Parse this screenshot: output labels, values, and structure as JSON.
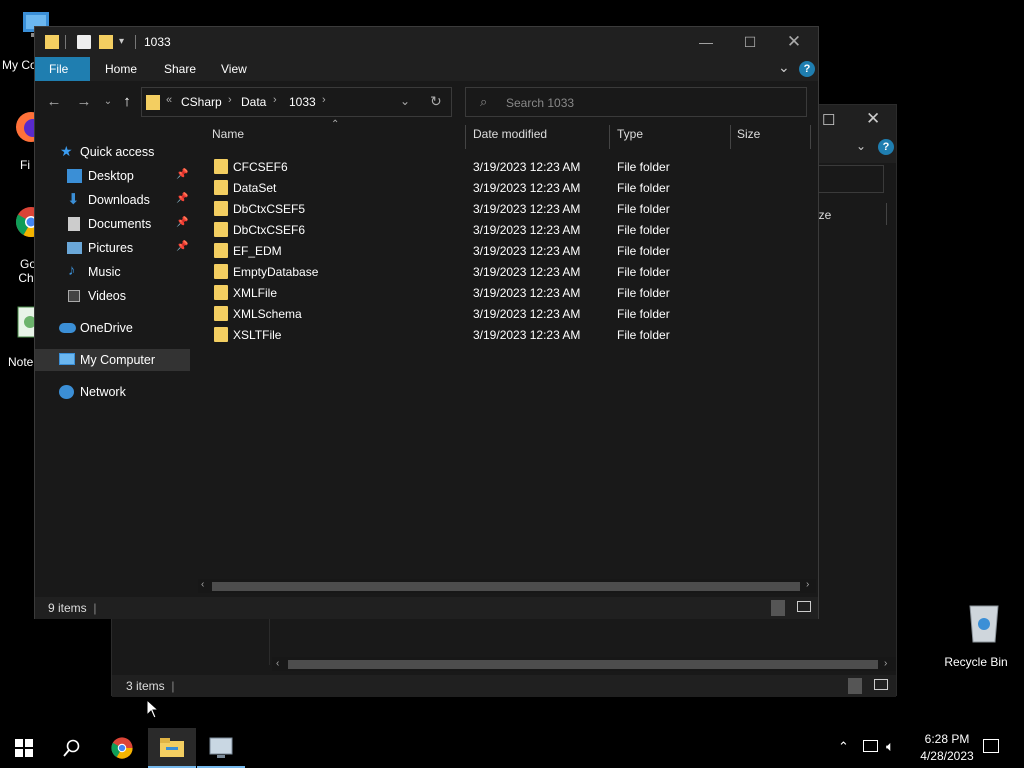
{
  "desktop": {
    "icons": [
      {
        "label": "My Co"
      },
      {
        "label": "Fi"
      },
      {
        "label": "Go Chr"
      },
      {
        "label": "Note"
      },
      {
        "label": "Recycle Bin"
      }
    ]
  },
  "back_window": {
    "size_header": "ize",
    "status": "3 items"
  },
  "window": {
    "title": "1033",
    "ribbon_tabs": [
      "File",
      "Home",
      "Share",
      "View"
    ],
    "address": {
      "overflow": "«",
      "crumbs": [
        "CSharp",
        "Data",
        "1033"
      ]
    },
    "search": {
      "placeholder": "Search 1033"
    },
    "nav": {
      "quick_access": "Quick access",
      "items": [
        {
          "label": "Desktop",
          "pinned": true,
          "icon": "desktop-icon"
        },
        {
          "label": "Downloads",
          "pinned": true,
          "icon": "downloads-icon"
        },
        {
          "label": "Documents",
          "pinned": true,
          "icon": "documents-icon"
        },
        {
          "label": "Pictures",
          "pinned": true,
          "icon": "pictures-icon"
        },
        {
          "label": "Music",
          "pinned": false,
          "icon": "music-icon"
        },
        {
          "label": "Videos",
          "pinned": false,
          "icon": "videos-icon"
        }
      ],
      "onedrive": "OneDrive",
      "my_computer": "My Computer",
      "network": "Network"
    },
    "columns": [
      "Name",
      "Date modified",
      "Type",
      "Size"
    ],
    "files": [
      {
        "name": "CFCSEF6",
        "date": "3/19/2023 12:23 AM",
        "type": "File folder"
      },
      {
        "name": "DataSet",
        "date": "3/19/2023 12:23 AM",
        "type": "File folder"
      },
      {
        "name": "DbCtxCSEF5",
        "date": "3/19/2023 12:23 AM",
        "type": "File folder"
      },
      {
        "name": "DbCtxCSEF6",
        "date": "3/19/2023 12:23 AM",
        "type": "File folder"
      },
      {
        "name": "EF_EDM",
        "date": "3/19/2023 12:23 AM",
        "type": "File folder"
      },
      {
        "name": "EmptyDatabase",
        "date": "3/19/2023 12:23 AM",
        "type": "File folder"
      },
      {
        "name": "XMLFile",
        "date": "3/19/2023 12:23 AM",
        "type": "File folder"
      },
      {
        "name": "XMLSchema",
        "date": "3/19/2023 12:23 AM",
        "type": "File folder"
      },
      {
        "name": "XSLTFile",
        "date": "3/19/2023 12:23 AM",
        "type": "File folder"
      }
    ],
    "status": "9 items"
  },
  "taskbar": {
    "time": "6:28 PM",
    "date": "4/28/2023"
  },
  "colors": {
    "accent": "#1f7eb0",
    "folder": "#f3ce61",
    "background": "#191919"
  }
}
